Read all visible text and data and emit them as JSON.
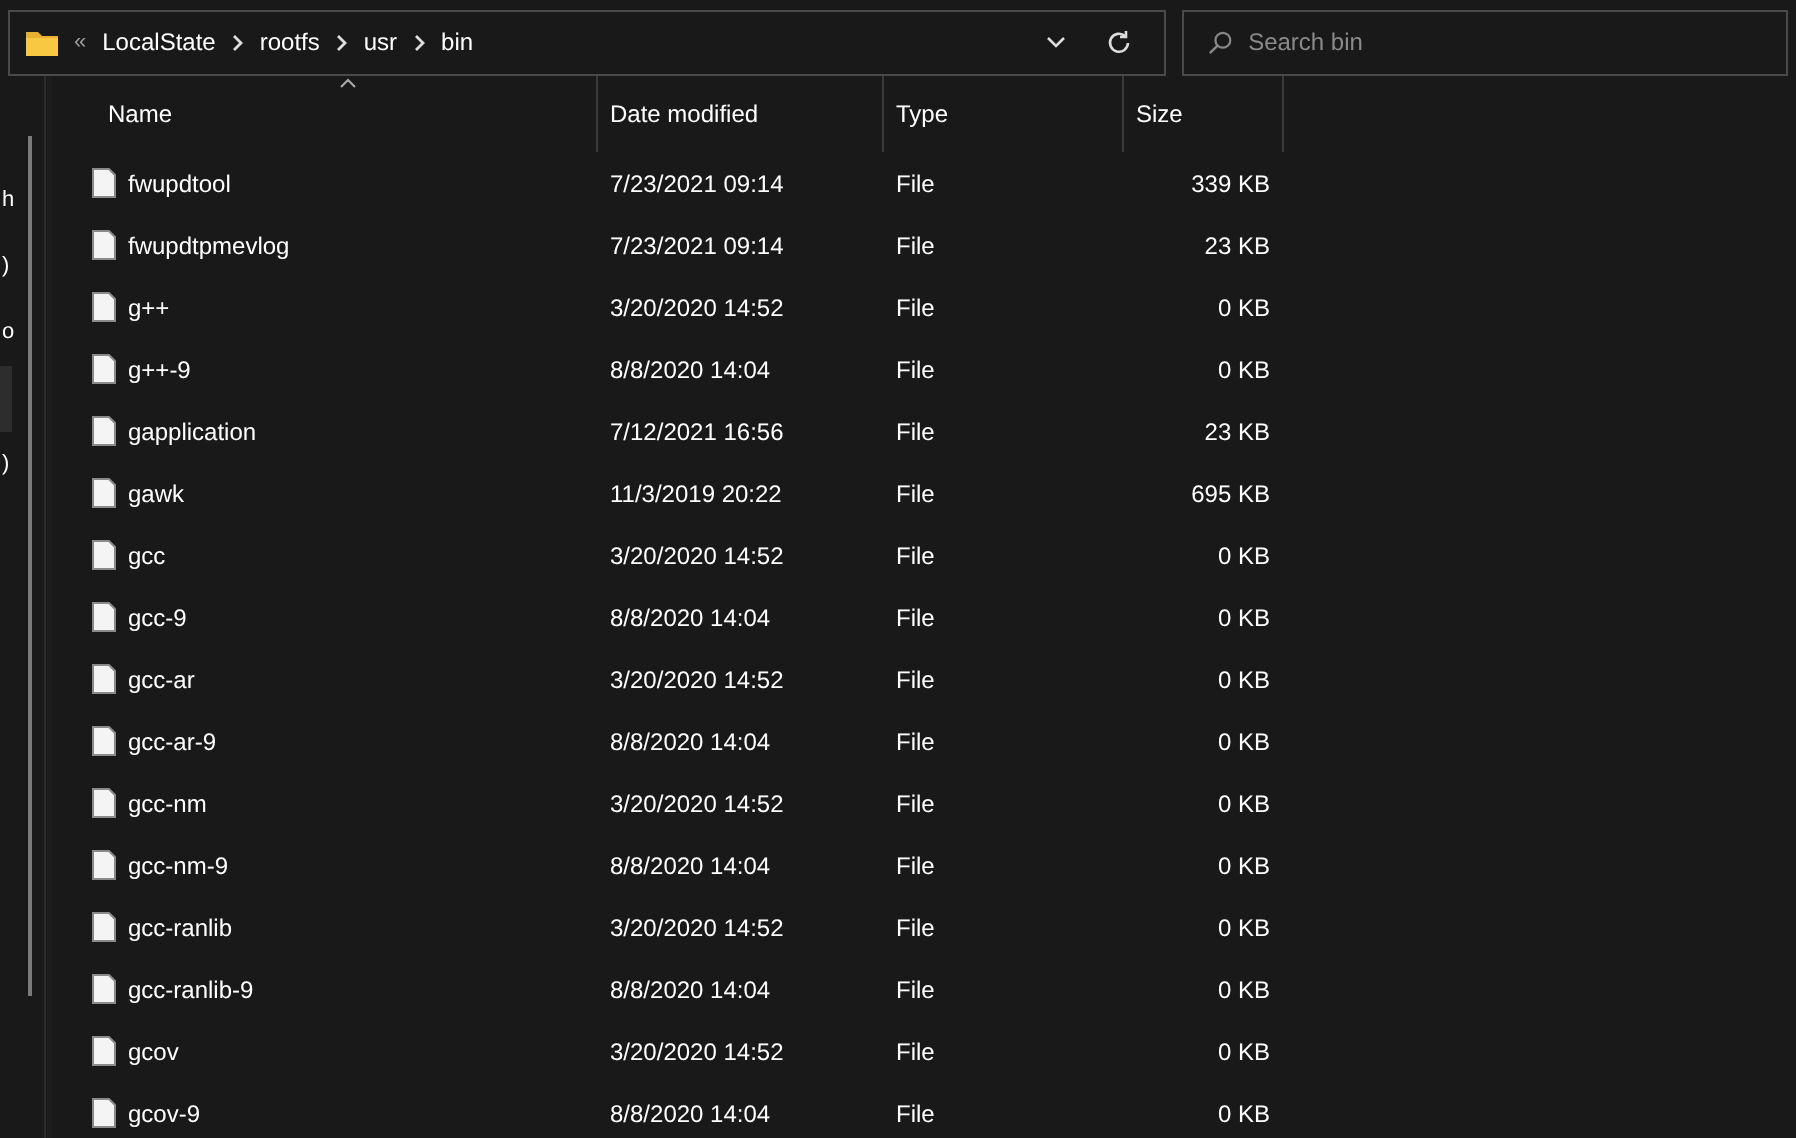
{
  "address_bar": {
    "overflow": "«",
    "path": [
      "LocalState",
      "rootfs",
      "usr",
      "bin"
    ]
  },
  "search": {
    "placeholder": "Search bin"
  },
  "sidebar": {
    "items": [
      {
        "label": "h",
        "selected": false
      },
      {
        "label": ")",
        "selected": false
      },
      {
        "label": "o",
        "selected": false
      },
      {
        "selected": true
      },
      {
        "label": ")",
        "selected": false
      }
    ]
  },
  "table": {
    "columns": [
      {
        "label": "Name",
        "sorted": true
      },
      {
        "label": "Date modified",
        "sorted": false
      },
      {
        "label": "Type",
        "sorted": false
      },
      {
        "label": "Size",
        "sorted": false
      }
    ],
    "rows": [
      {
        "name": "fwupdtool",
        "date": "7/23/2021 09:14",
        "type": "File",
        "size": "339 KB"
      },
      {
        "name": "fwupdtpmevlog",
        "date": "7/23/2021 09:14",
        "type": "File",
        "size": "23 KB"
      },
      {
        "name": "g++",
        "date": "3/20/2020 14:52",
        "type": "File",
        "size": "0 KB"
      },
      {
        "name": "g++-9",
        "date": "8/8/2020 14:04",
        "type": "File",
        "size": "0 KB"
      },
      {
        "name": "gapplication",
        "date": "7/12/2021 16:56",
        "type": "File",
        "size": "23 KB"
      },
      {
        "name": "gawk",
        "date": "11/3/2019 20:22",
        "type": "File",
        "size": "695 KB"
      },
      {
        "name": "gcc",
        "date": "3/20/2020 14:52",
        "type": "File",
        "size": "0 KB"
      },
      {
        "name": "gcc-9",
        "date": "8/8/2020 14:04",
        "type": "File",
        "size": "0 KB"
      },
      {
        "name": "gcc-ar",
        "date": "3/20/2020 14:52",
        "type": "File",
        "size": "0 KB"
      },
      {
        "name": "gcc-ar-9",
        "date": "8/8/2020 14:04",
        "type": "File",
        "size": "0 KB"
      },
      {
        "name": "gcc-nm",
        "date": "3/20/2020 14:52",
        "type": "File",
        "size": "0 KB"
      },
      {
        "name": "gcc-nm-9",
        "date": "8/8/2020 14:04",
        "type": "File",
        "size": "0 KB"
      },
      {
        "name": "gcc-ranlib",
        "date": "3/20/2020 14:52",
        "type": "File",
        "size": "0 KB"
      },
      {
        "name": "gcc-ranlib-9",
        "date": "8/8/2020 14:04",
        "type": "File",
        "size": "0 KB"
      },
      {
        "name": "gcov",
        "date": "3/20/2020 14:52",
        "type": "File",
        "size": "0 KB"
      },
      {
        "name": "gcov-9",
        "date": "8/8/2020 14:04",
        "type": "File",
        "size": "0 KB"
      }
    ]
  }
}
